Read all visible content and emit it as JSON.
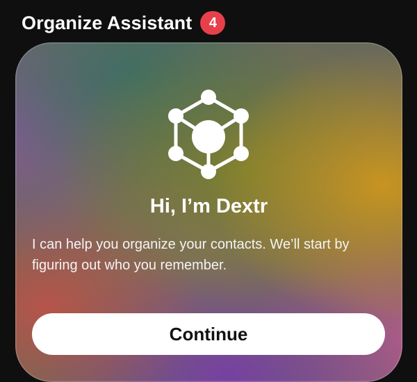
{
  "header": {
    "title": "Organize Assistant",
    "badge_count": "4"
  },
  "card": {
    "icon": "cube-network-icon",
    "greeting": "Hi, I’m Dextr",
    "description": "I can help you organize your contacts. We’ll start by figuring out who you remember.",
    "continue_label": "Continue"
  },
  "colors": {
    "background": "#0f0f10",
    "badge": "#e8404a",
    "button": "#ffffff",
    "button_text": "#111111"
  }
}
